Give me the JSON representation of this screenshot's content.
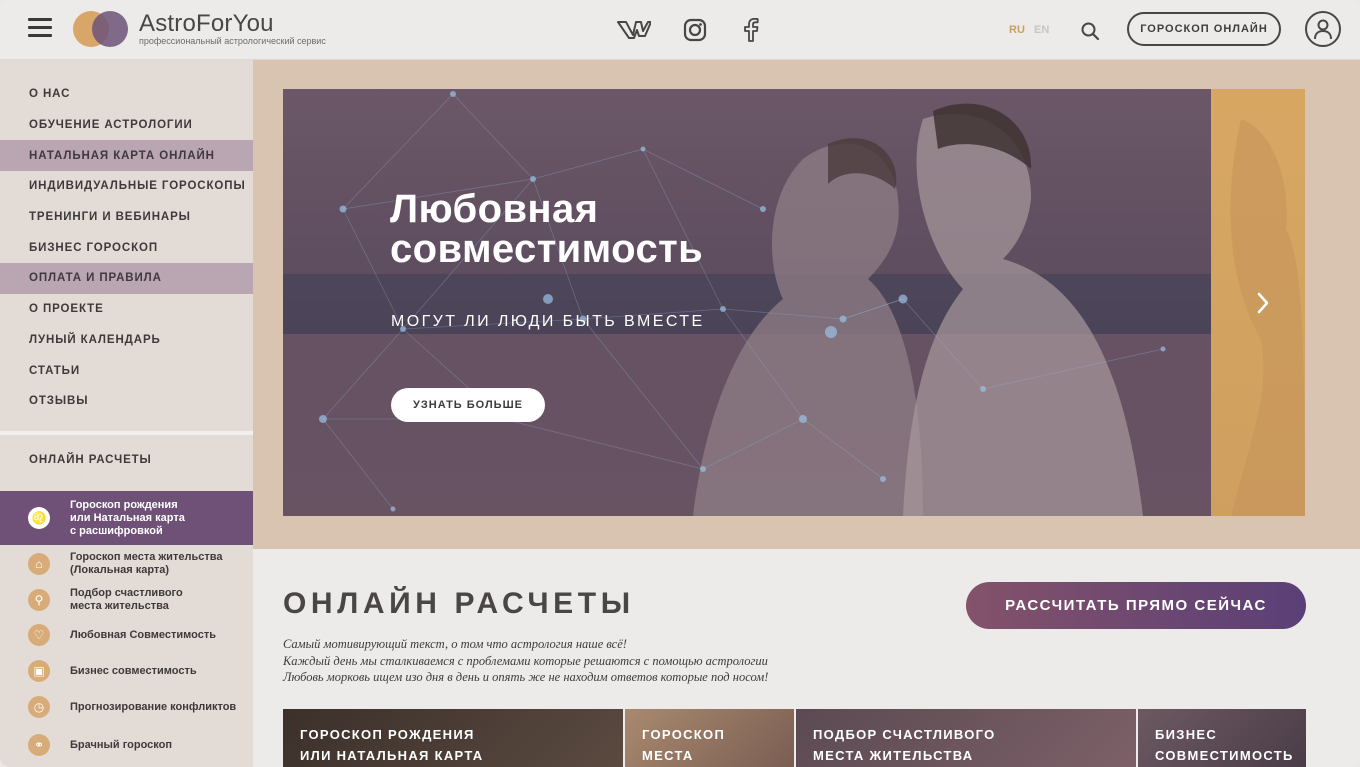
{
  "header": {
    "logo_title": "AstroForYou",
    "logo_subtitle": "профессиональный астрологический сервис",
    "social": [
      "vk-icon",
      "instagram-icon",
      "facebook-icon"
    ],
    "lang_ru": "RU",
    "lang_en": "EN",
    "horoscope_button": "ГОРОСКОП ОНЛАЙН"
  },
  "sidebar": {
    "nav": [
      {
        "label": "О НАС",
        "active": false
      },
      {
        "label": "ОБУЧЕНИЕ АСТРОЛОГИИ",
        "active": false
      },
      {
        "label": "НАТАЛЬНАЯ КАРТА ОНЛАЙН",
        "active": true
      },
      {
        "label": "ИНДИВИДУАЛЬНЫЕ ГОРОСКОПЫ",
        "active": false
      },
      {
        "label": "ТРЕНИНГИ И ВЕБИНАРЫ",
        "active": false
      },
      {
        "label": "БИЗНЕС ГОРОСКОП",
        "active": false
      },
      {
        "label": "ОПЛАТА И ПРАВИЛА",
        "active": true
      },
      {
        "label": "О ПРОЕКТЕ",
        "active": false
      },
      {
        "label": "ЛУНЫЙ КАЛЕНДАРЬ",
        "active": false
      },
      {
        "label": "СТАТЬИ",
        "active": false
      },
      {
        "label": "ОТЗЫВЫ",
        "active": false
      }
    ],
    "section_title": "ОНЛАЙН РАСЧЕТЫ",
    "calc_items": [
      {
        "line1": "Гороскоп рождения",
        "line2": "или Натальная карта",
        "line3": "с расшифровкой",
        "icon": "natal-chart-icon",
        "active": true
      },
      {
        "line1": "Гороскоп места жительства",
        "line2": "(Локальная карта)",
        "line3": "",
        "icon": "home-icon",
        "active": false
      },
      {
        "line1": "Подбор счастливого",
        "line2": "места жительства",
        "line3": "",
        "icon": "location-icon",
        "active": false
      },
      {
        "line1": "Любовная Совместимость",
        "line2": "",
        "line3": "",
        "icon": "heart-icon",
        "active": false
      },
      {
        "line1": "Бизнес совместимость",
        "line2": "",
        "line3": "",
        "icon": "briefcase-icon",
        "active": false
      },
      {
        "line1": "Прогнозирование конфликтов",
        "line2": "",
        "line3": "",
        "icon": "forecast-icon",
        "active": false
      },
      {
        "line1": "Брачный гороскоп",
        "line2": "",
        "line3": "",
        "icon": "rings-icon",
        "active": false
      }
    ]
  },
  "hero": {
    "title_line1": "Любовная",
    "title_line2": "совместимость",
    "subtitle": "МОГУТ ЛИ ЛЮДИ БЫТЬ ВМЕСТЕ",
    "button": "УЗНАТЬ БОЛЬШЕ"
  },
  "online": {
    "title": "ОНЛАЙН РАСЧЕТЫ",
    "desc_line1": "Самый мотивирующий текст, о том что астрология наше всё!",
    "desc_line2": "Каждый день мы сталкиваемся с проблемами которые решаются с помощью астрологии",
    "desc_line3": "Любовь морковь ищем изо дня в день и опять же не находим ответов которые под носом!",
    "cta": "РАССЧИТАТЬ ПРЯМО СЕЙЧАС",
    "cards": [
      {
        "line1": "ГОРОСКОП РОЖДЕНИЯ",
        "line2": "ИЛИ НАТАЛЬНАЯ КАРТА"
      },
      {
        "line1": "ГОРОСКОП",
        "line2": "МЕСТА"
      },
      {
        "line1": "ПОДБОР СЧАСТЛИВОГО",
        "line2": "МЕСТА ЖИТЕЛЬСТВА"
      },
      {
        "line1": "БИЗНЕС",
        "line2": "СОВМЕСТИМОСТЬ"
      }
    ]
  },
  "colors": {
    "accent_purple": "#6f5178",
    "accent_gold": "#d7a762",
    "nav_highlight": "#b9a6b2"
  }
}
